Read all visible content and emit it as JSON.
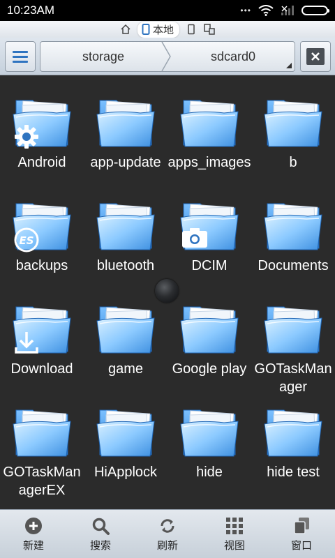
{
  "status_bar": {
    "time": "10:23AM"
  },
  "mode_strip": {
    "local_label": "本地"
  },
  "path_bar": {
    "crumbs": [
      "storage",
      "sdcard0"
    ]
  },
  "folders": [
    {
      "label": "Android",
      "badge": "gear-icon"
    },
    {
      "label": "app-update"
    },
    {
      "label": "apps_images"
    },
    {
      "label": "b"
    },
    {
      "label": "backups",
      "badge": "es-logo-icon"
    },
    {
      "label": "bluetooth"
    },
    {
      "label": "DCIM",
      "badge": "camera-icon"
    },
    {
      "label": "Documents"
    },
    {
      "label": "Download",
      "badge": "download-icon"
    },
    {
      "label": "game"
    },
    {
      "label": "Google play"
    },
    {
      "label": "GOTaskManager"
    },
    {
      "label": "GOTaskManagerEX"
    },
    {
      "label": "HiApplock"
    },
    {
      "label": "hide"
    },
    {
      "label": "hide test"
    }
  ],
  "bottom_bar": {
    "items": [
      {
        "label": "新建",
        "icon": "plus-circle-icon"
      },
      {
        "label": "搜索",
        "icon": "search-icon"
      },
      {
        "label": "刷新",
        "icon": "refresh-icon"
      },
      {
        "label": "视图",
        "icon": "grid-view-icon"
      },
      {
        "label": "窗口",
        "icon": "windows-icon"
      }
    ]
  },
  "colors": {
    "accent": "#2f74c0",
    "folder_light": "#bfe3ff",
    "folder_dark": "#3d8fe0",
    "background": "#2b2b2b"
  }
}
